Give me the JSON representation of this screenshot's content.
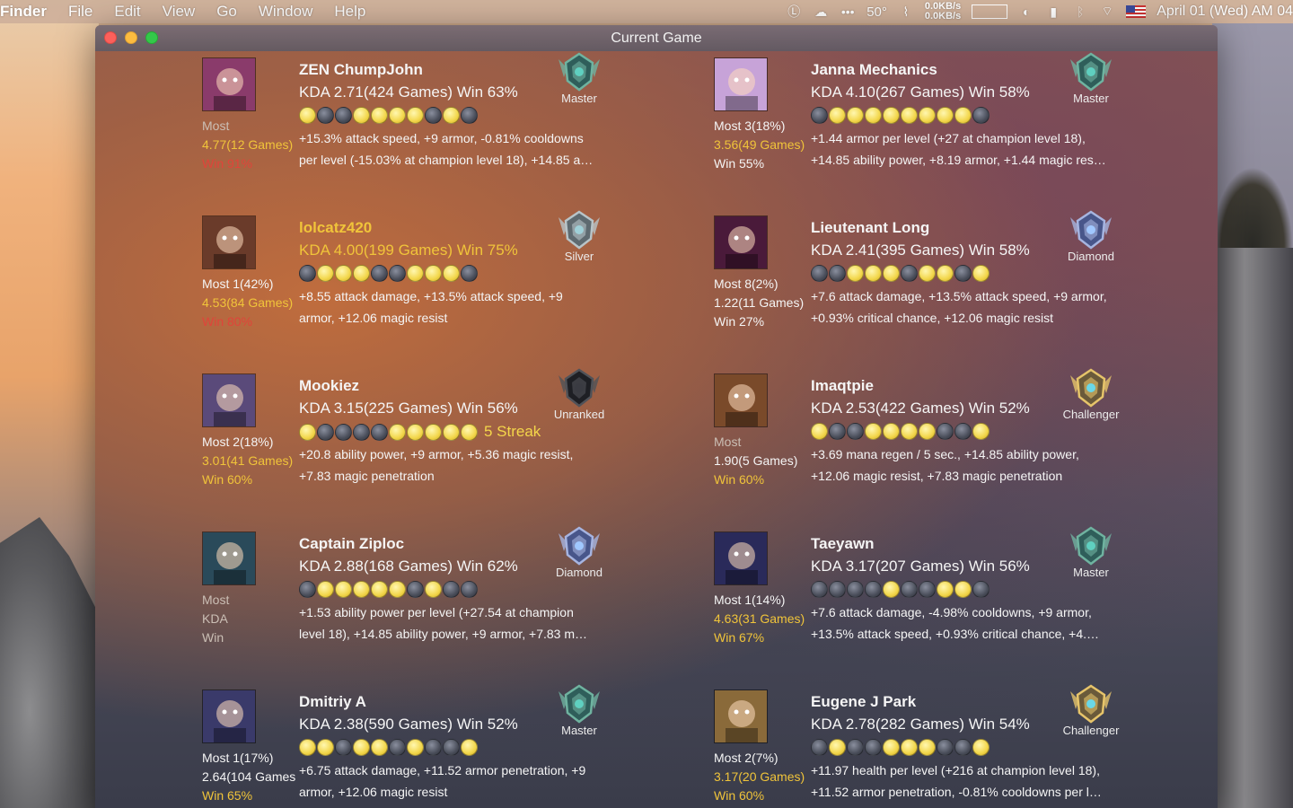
{
  "menubar": {
    "app": "Finder",
    "items": [
      "File",
      "Edit",
      "View",
      "Go",
      "Window",
      "Help"
    ],
    "temperature": "50°",
    "net_up": "0.0KB/s",
    "net_down": "0.0KB/s",
    "clock": "April 01 (Wed) AM 04"
  },
  "window": {
    "title": "Current Game"
  },
  "players": [
    {
      "name": "ZEN ChumpJohn",
      "name_color": "white",
      "kda_line": "KDA 2.71(424 Games) Win 63%",
      "kda_color": "white",
      "most": [
        "Most",
        "4.77(12 Games)",
        "Win 91%"
      ],
      "most_colors": [
        "grey",
        "gold",
        "red"
      ],
      "dots": "wllwwwwlwl",
      "streak": "",
      "runes": [
        "+15.3% attack speed, +9 armor, -0.81% cooldowns",
        "per level (-15.03% at champion level 18), +14.85 a…"
      ],
      "rank": "Master",
      "portrait_color": "#8a3b6b"
    },
    {
      "name": "Janna Mechanics",
      "name_color": "white",
      "kda_line": "KDA 4.10(267 Games) Win 58%",
      "kda_color": "white",
      "most": [
        "Most 3(18%)",
        "3.56(49 Games)",
        "Win 55%"
      ],
      "most_colors": [
        "white",
        "gold",
        "white"
      ],
      "dots": "lwwwwwwwwl",
      "streak": "",
      "runes": [
        "+1.44 armor per level (+27 at champion level 18),",
        "+14.85 ability power, +8.19 armor, +1.44 magic res…"
      ],
      "rank": "Master",
      "portrait_color": "#c7a3d8"
    },
    {
      "name": "lolcatz420",
      "name_color": "gold",
      "kda_line": "KDA 4.00(199 Games) Win 75%",
      "kda_color": "gold",
      "most": [
        "Most 1(42%)",
        "4.53(84 Games)",
        "Win 80%"
      ],
      "most_colors": [
        "white",
        "gold",
        "red"
      ],
      "dots": "lwwwllwwwl",
      "streak": "",
      "runes": [
        "+8.55 attack damage, +13.5% attack speed, +9",
        "armor, +12.06 magic resist"
      ],
      "rank": "Silver",
      "portrait_color": "#6a3b2a"
    },
    {
      "name": "Lieutenant Long",
      "name_color": "white",
      "kda_line": "KDA 2.41(395 Games) Win 58%",
      "kda_color": "white",
      "most": [
        "Most 8(2%)",
        "1.22(11 Games)",
        "Win 27%"
      ],
      "most_colors": [
        "white",
        "white",
        "white"
      ],
      "dots": "llwwwlwwlw",
      "streak": "",
      "runes": [
        "+7.6 attack damage, +13.5% attack speed, +9 armor,",
        "+0.93% critical chance, +12.06 magic resist"
      ],
      "rank": "Diamond",
      "portrait_color": "#4a1a3a"
    },
    {
      "name": "Mookiez",
      "name_color": "white",
      "kda_line": "KDA 3.15(225 Games) Win 56%",
      "kda_color": "white",
      "most": [
        "Most 2(18%)",
        "3.01(41 Games)",
        "Win 60%"
      ],
      "most_colors": [
        "white",
        "gold",
        "gold"
      ],
      "dots": "wllllwwwww",
      "streak": "5 Streak",
      "runes": [
        "+20.8 ability power, +9 armor, +5.36 magic resist,",
        "+7.83 magic penetration"
      ],
      "rank": "Unranked",
      "portrait_color": "#5a4a7a"
    },
    {
      "name": "Imaqtpie",
      "name_color": "white",
      "kda_line": "KDA 2.53(422 Games) Win 52%",
      "kda_color": "white",
      "most": [
        "Most",
        "1.90(5 Games)",
        "Win 60%"
      ],
      "most_colors": [
        "grey",
        "white",
        "gold"
      ],
      "dots": "wllwwwwllw",
      "streak": "",
      "runes": [
        "+3.69 mana regen / 5 sec., +14.85 ability power,",
        "+12.06 magic resist, +7.83 magic penetration"
      ],
      "rank": "Challenger",
      "portrait_color": "#7a4a2a"
    },
    {
      "name": "Captain Ziploc",
      "name_color": "white",
      "kda_line": "KDA 2.88(168 Games) Win 62%",
      "kda_color": "white",
      "most": [
        "Most",
        "KDA",
        "Win"
      ],
      "most_colors": [
        "grey",
        "grey",
        "grey"
      ],
      "dots": "lwwwwwlwll",
      "streak": "",
      "runes": [
        "+1.53 ability power per level (+27.54 at champion",
        "level 18), +14.85 ability power, +9 armor, +7.83 m…"
      ],
      "rank": "Diamond",
      "portrait_color": "#2a4a5a"
    },
    {
      "name": "Taeyawn",
      "name_color": "white",
      "kda_line": "KDA 3.17(207 Games) Win 56%",
      "kda_color": "white",
      "most": [
        "Most 1(14%)",
        "4.63(31 Games)",
        "Win 67%"
      ],
      "most_colors": [
        "white",
        "gold",
        "gold"
      ],
      "dots": "llllwllwwl",
      "streak": "",
      "runes": [
        "+7.6 attack damage, -4.98% cooldowns, +9 armor,",
        "+13.5% attack speed, +0.93% critical chance, +4.…"
      ],
      "rank": "Master",
      "portrait_color": "#2a2a5a"
    },
    {
      "name": "Dmitriy A",
      "name_color": "white",
      "kda_line": "KDA 2.38(590 Games) Win 52%",
      "kda_color": "white",
      "most": [
        "Most 1(17%)",
        "2.64(104 Games",
        "Win 65%"
      ],
      "most_colors": [
        "white",
        "white",
        "gold"
      ],
      "dots": "wwlwwlwllw",
      "streak": "",
      "runes": [
        "+6.75 attack damage, +11.52 armor penetration, +9",
        "armor, +12.06 magic resist"
      ],
      "rank": "Master",
      "portrait_color": "#3a3a6a"
    },
    {
      "name": "Eugene J Park",
      "name_color": "white",
      "kda_line": "KDA 2.78(282 Games) Win 54%",
      "kda_color": "white",
      "most": [
        "Most 2(7%)",
        "3.17(20 Games)",
        "Win 60%"
      ],
      "most_colors": [
        "white",
        "gold",
        "gold"
      ],
      "dots": "lwllwwwllw",
      "streak": "",
      "runes": [
        "+11.97 health per level (+216 at champion level 18),",
        "+11.52 armor penetration, -0.81% cooldowns per l…"
      ],
      "rank": "Challenger",
      "portrait_color": "#8a6a3a"
    }
  ],
  "colors": {
    "gold": "#f0c43a",
    "red": "#e0443a",
    "win_dot": "#f2d64a",
    "loss_dot": "#4a4e5a"
  }
}
